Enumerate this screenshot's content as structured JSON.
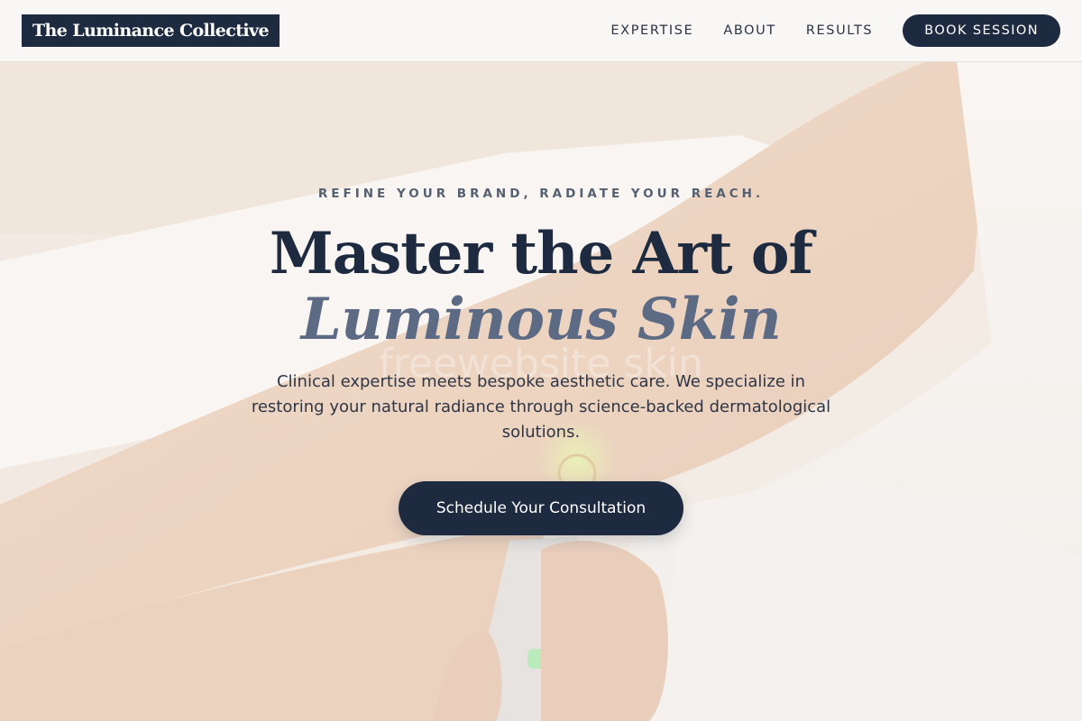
{
  "navbar": {
    "logo_text": "The Luminance Collective",
    "links": [
      {
        "label": "EXPERTISE"
      },
      {
        "label": "ABOUT"
      },
      {
        "label": "RESULTS"
      }
    ],
    "cta_label": "BOOK SESSION"
  },
  "hero": {
    "tagline": "REFINE YOUR BRAND, RADIATE YOUR REACH.",
    "headline_line1": "Master the Art of",
    "headline_line2": "Luminous Skin",
    "watermark": "freewebsite skin",
    "description": "Clinical expertise meets bespoke aesthetic care. We specialize in restoring your natural radiance through science-backed dermatological solutions.",
    "cta_label": "Schedule Your Consultation"
  },
  "colors": {
    "navy": "#1e2a40",
    "slate_italic": "#5d6a84",
    "tagline_gray": "#556070",
    "background_cream": "#f4efe9"
  }
}
